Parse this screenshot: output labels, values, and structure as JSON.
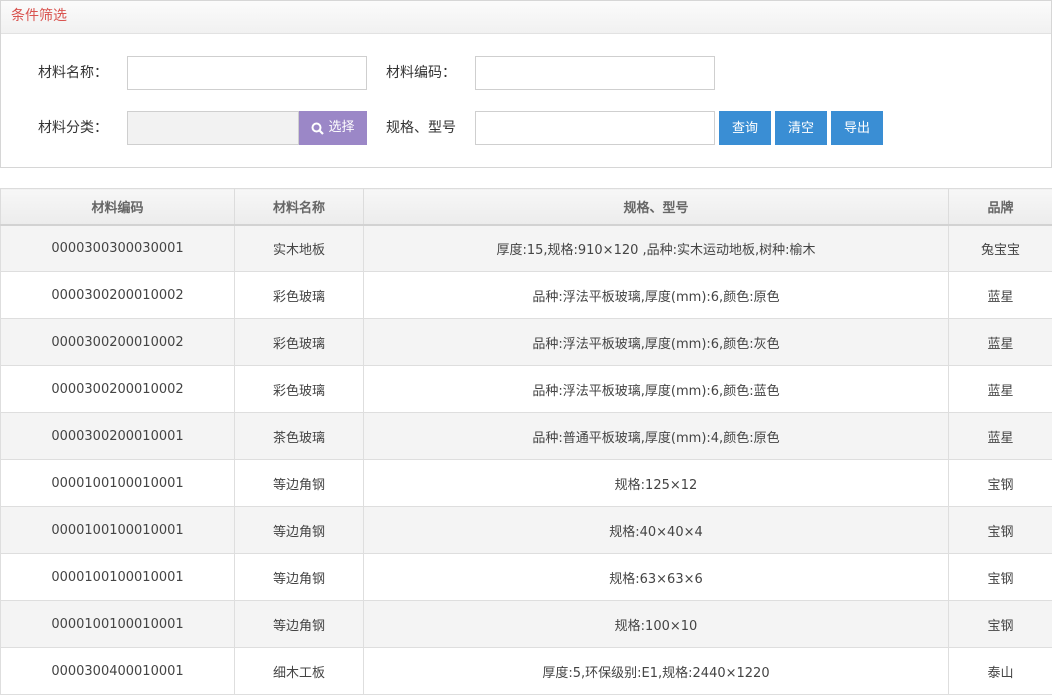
{
  "filter": {
    "title": "条件筛选",
    "material_name_label": "材料名称：",
    "material_code_label": "材料编码：",
    "material_category_label": "材料分类：",
    "spec_label": "规格、型号",
    "material_name_value": "",
    "material_code_value": "",
    "material_category_value": "",
    "spec_value": "",
    "select_button": "选择",
    "query_button": "查询",
    "clear_button": "清空",
    "export_button": "导出"
  },
  "table": {
    "headers": [
      "材料编码",
      "材料名称",
      "规格、型号",
      "品牌"
    ],
    "rows": [
      {
        "code": "000030030003000 1",
        "name": "实木地板",
        "spec": "厚度:15,规格:910×120 ,品种:实木运动地板,树种:榆木",
        "brand": "兔宝宝"
      },
      {
        "code": "0000300200010002",
        "name": "彩色玻璃",
        "spec": "品种:浮法平板玻璃,厚度(mm):6,颜色:原色",
        "brand": "蓝星"
      },
      {
        "code": "0000300200010002",
        "name": "彩色玻璃",
        "spec": "品种:浮法平板玻璃,厚度(mm):6,颜色:灰色",
        "brand": "蓝星"
      },
      {
        "code": "0000300200010002",
        "name": "彩色玻璃",
        "spec": "品种:浮法平板玻璃,厚度(mm):6,颜色:蓝色",
        "brand": "蓝星"
      },
      {
        "code": "0000300200010001",
        "name": "茶色玻璃",
        "spec": "品种:普通平板玻璃,厚度(mm):4,颜色:原色",
        "brand": "蓝星"
      },
      {
        "code": "0000100100010001",
        "name": "等边角钢",
        "spec": "规格:125×12",
        "brand": "宝钢"
      },
      {
        "code": "0000100100010001",
        "name": "等边角钢",
        "spec": "规格:40×40×4",
        "brand": "宝钢"
      },
      {
        "code": "0000100100010001",
        "name": "等边角钢",
        "spec": "规格:63×63×6",
        "brand": "宝钢"
      },
      {
        "code": "0000100100010001",
        "name": "等边角钢",
        "spec": "规格:100×10",
        "brand": "宝钢"
      },
      {
        "code": "0000300400010001",
        "name": "细木工板",
        "spec": "厚度:5,环保级别:E1,规格:2440×1220",
        "brand": "泰山"
      }
    ]
  },
  "colors": {
    "accent_title": "#d9534f",
    "select_button_bg": "#9b87c7",
    "action_button_bg": "#3a8ed4"
  }
}
